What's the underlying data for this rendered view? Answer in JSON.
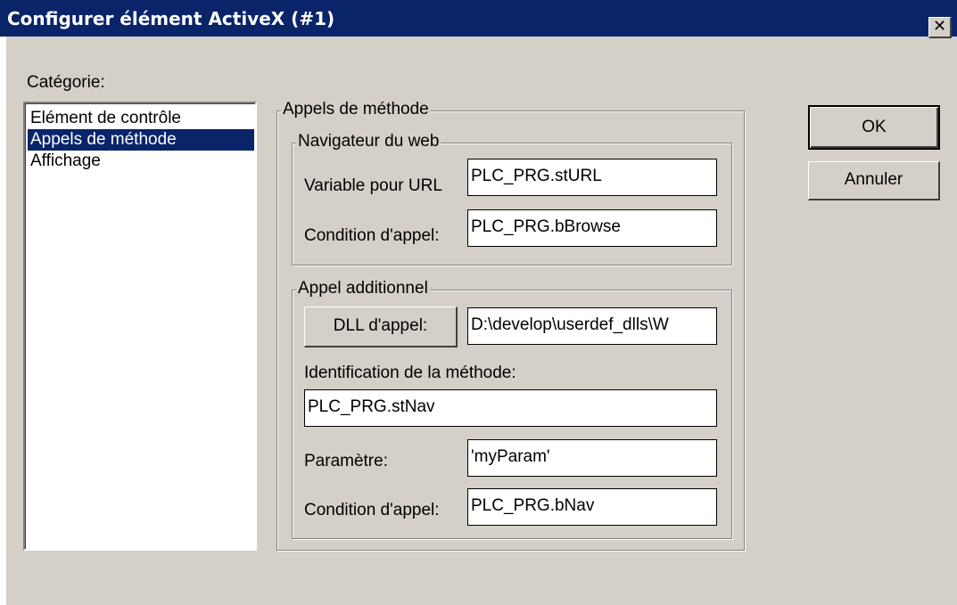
{
  "window": {
    "title": "Configurer élément ActiveX (#1)",
    "close_glyph": "✕"
  },
  "category": {
    "label": "Catégorie:",
    "items": [
      {
        "label": "Elément de contrôle",
        "selected": false
      },
      {
        "label": "Appels de méthode",
        "selected": true
      },
      {
        "label": "Affichage",
        "selected": false
      }
    ]
  },
  "method_calls": {
    "group_label": "Appels de méthode",
    "web_browser": {
      "group_label": "Navigateur du web",
      "url_label": "Variable pour URL",
      "url_value": "PLC_PRG.stURL",
      "condition_label": "Condition d'appel:",
      "condition_value": "PLC_PRG.bBrowse"
    },
    "additional_call": {
      "group_label": "Appel additionnel",
      "dll_button_label": "DLL d'appel:",
      "dll_value": "D:\\develop\\userdef_dlls\\W",
      "method_id_label": "Identification de la méthode:",
      "method_id_value": "PLC_PRG.stNav",
      "parameter_label": "Paramètre:",
      "parameter_value": "'myParam'",
      "condition_label": "Condition d'appel:",
      "condition_value": "PLC_PRG.bNav"
    }
  },
  "buttons": {
    "ok_label": "OK",
    "cancel_label": "Annuler"
  },
  "colors": {
    "titlebar": "#0a246a",
    "window_bg": "#d4d0c8",
    "selection": "#0a246a"
  }
}
